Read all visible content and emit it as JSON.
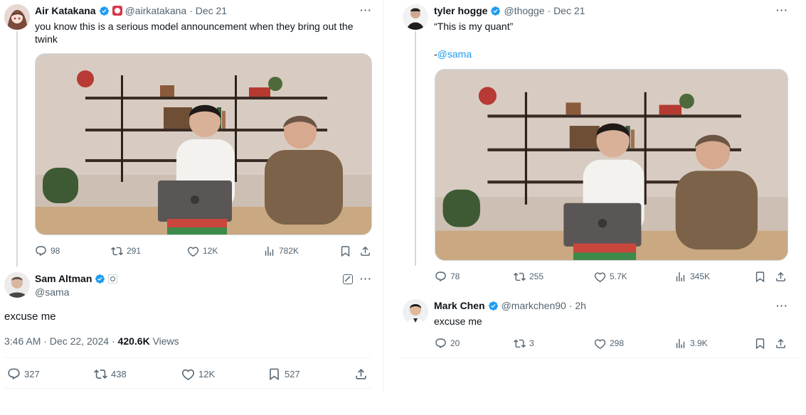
{
  "left": {
    "tweet": {
      "name": "Air Katakana",
      "handle": "@airkatakana",
      "date": "· Dec 21",
      "text": "you know this is a serious model announcement when they bring out the twink",
      "stats": {
        "replies": "98",
        "retweets": "291",
        "likes": "12K",
        "views": "782K"
      }
    },
    "reply": {
      "name": "Sam Altman",
      "handle": "@sama",
      "text": "excuse me",
      "timestamp": "3:46 AM · Dec 22, 2024 · ",
      "views_count": "420.6K",
      "views_label": " Views",
      "stats": {
        "replies": "327",
        "retweets": "438",
        "likes": "12K",
        "bookmarks": "527"
      }
    }
  },
  "right": {
    "tweet": {
      "name": "tyler hogge",
      "handle": "@thogge",
      "date": "· Dec 21",
      "quote": "“This is my quant”",
      "attribution_dash": "-",
      "attribution_link": "@sama",
      "stats": {
        "replies": "78",
        "retweets": "255",
        "likes": "5.7K",
        "views": "345K"
      }
    },
    "reply": {
      "name": "Mark Chen",
      "handle": "@markchen90",
      "date": "· 2h",
      "text": "excuse me",
      "stats": {
        "replies": "20",
        "retweets": "3",
        "likes": "298",
        "views": "3.9K"
      }
    }
  },
  "more_glyph": "···",
  "colors": {
    "accent": "#1d9bf0",
    "muted": "#536471",
    "text": "#0f1419",
    "line": "#cfd9de"
  }
}
